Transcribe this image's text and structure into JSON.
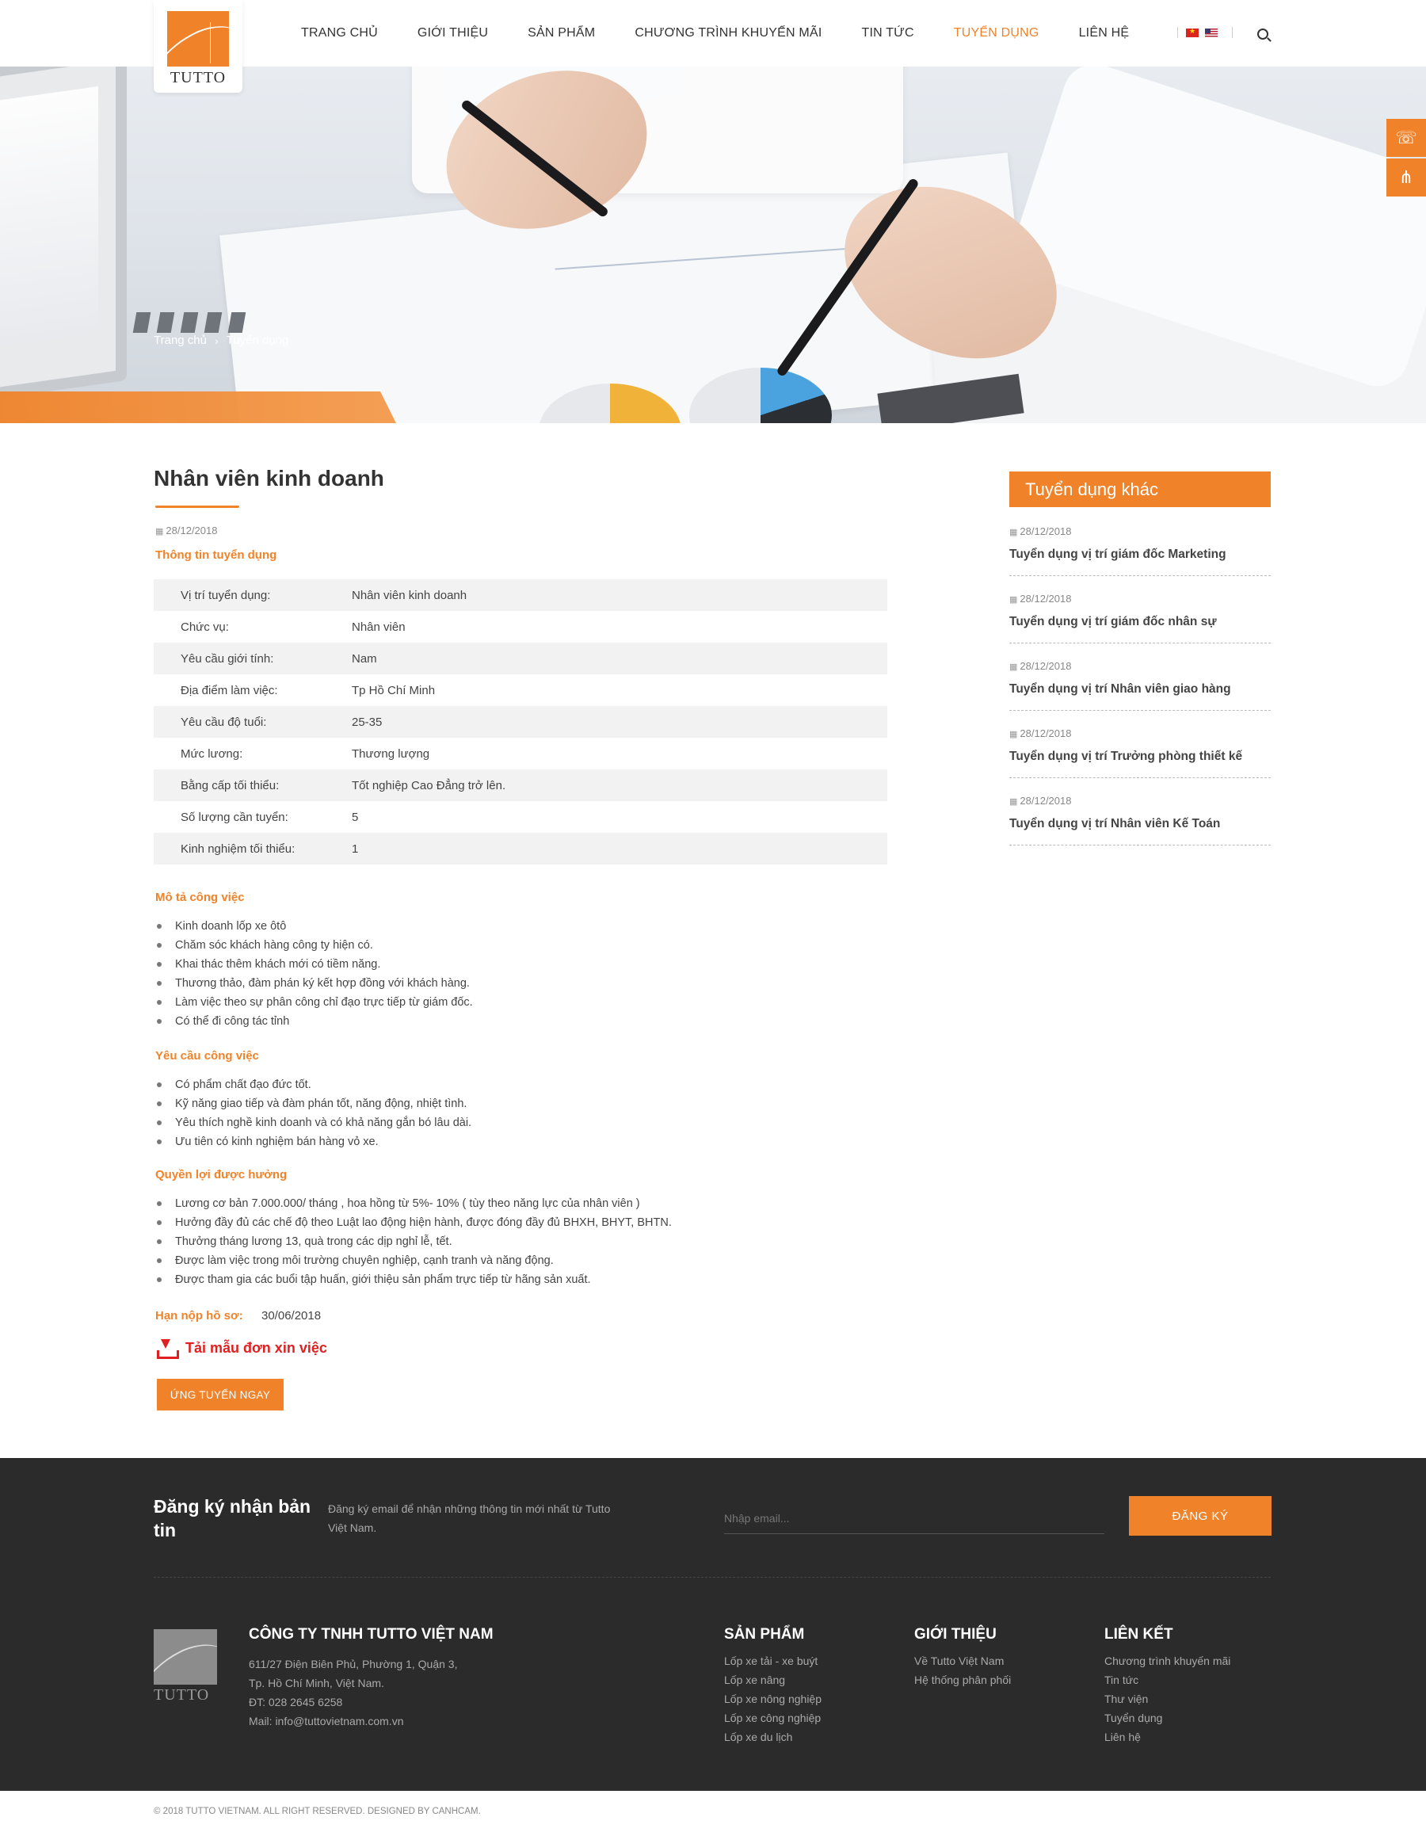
{
  "header": {
    "logo_text": "TUTTO",
    "nav": [
      "TRANG CHỦ",
      "GIỚI THIỆU",
      "SẢN PHẨM",
      "CHƯƠNG TRÌNH KHUYẾN MÃI",
      "TIN TỨC",
      "TUYỂN DỤNG",
      "LIÊN HỆ"
    ],
    "active_nav": "TUYỂN DỤNG",
    "languages": [
      "vi-flag-icon",
      "en-flag-icon"
    ]
  },
  "breadcrumb": [
    "Trang chủ",
    "Tuyển dụng"
  ],
  "side_widgets": [
    "phone-icon",
    "share-icon"
  ],
  "job": {
    "title": "Nhân viên kinh doanh",
    "date": "28/12/2018",
    "info_heading": "Thông tin tuyển dụng",
    "info": [
      {
        "label": "Vị trí tuyển dụng:",
        "value": "Nhân viên kinh doanh"
      },
      {
        "label": "Chức vụ:",
        "value": "Nhân viên"
      },
      {
        "label": "Yêu cầu giới tính:",
        "value": "Nam"
      },
      {
        "label": "Địa điểm làm việc:",
        "value": "Tp Hồ Chí Minh"
      },
      {
        "label": "Yêu cầu độ tuổi:",
        "value": "25-35"
      },
      {
        "label": "Mức lương:",
        "value": "Thương lượng"
      },
      {
        "label": "Bằng cấp tối thiểu:",
        "value": "Tốt nghiệp Cao Đẳng trở lên."
      },
      {
        "label": "Số lượng cần tuyển:",
        "value": "5"
      },
      {
        "label": "Kinh nghiệm tối thiểu:",
        "value": "1"
      }
    ],
    "description_heading": "Mô tả công việc",
    "description": [
      "Kinh doanh lốp xe ôtô",
      "Chăm sóc khách hàng công ty hiện có.",
      "Khai thác thêm khách mới có tiềm năng.",
      "Thương thảo, đàm phán ký kết hợp đồng với khách hàng.",
      "Làm việc theo sự phân công chỉ đạo trực tiếp từ giám đốc.",
      "Có thể đi công tác tỉnh"
    ],
    "requirements_heading": "Yêu cầu công việc",
    "requirements": [
      "Có phẩm chất đạo đức tốt.",
      "Kỹ năng giao tiếp và đàm phán tốt, năng động, nhiệt tình.",
      "Yêu thích nghề kinh doanh và có khả năng gắn bó lâu dài.",
      "Ưu tiên có kinh nghiệm bán hàng vỏ xe."
    ],
    "benefits_heading": "Quyền lợi được hưởng",
    "benefits": [
      " Lương cơ bản 7.000.000/ tháng , hoa hồng từ 5%- 10% ( tùy theo năng lực của nhân viên )",
      "Hưởng đầy đủ các chế độ theo Luật lao động hiện hành, được đóng đầy đủ BHXH, BHYT, BHTN.",
      "Thưởng tháng lương 13, quà trong các dịp nghỉ lễ, tết.",
      "Được làm việc trong môi trường chuyên nghiệp, cạnh tranh và năng động.",
      "Được tham gia các buổi tập huấn, giới thiệu sản phẩm trực tiếp từ hãng sản xuất."
    ],
    "deadline_label": "Hạn nộp hồ sơ:",
    "deadline_value": "30/06/2018",
    "download_label": "Tải mẫu đơn xin việc",
    "apply_label": "ỨNG TUYỂN NGAY"
  },
  "sidebar": {
    "heading": "Tuyển dụng khác",
    "items": [
      {
        "date": "28/12/2018",
        "title": "Tuyển dụng vị trí giám đốc Marketing"
      },
      {
        "date": "28/12/2018",
        "title": "Tuyển dụng vị trí giám đốc nhân sự"
      },
      {
        "date": "28/12/2018",
        "title": "Tuyển dụng vị trí Nhân viên giao hàng"
      },
      {
        "date": "28/12/2018",
        "title": "Tuyển dụng vị trí Trưởng phòng thiết kế"
      },
      {
        "date": "28/12/2018",
        "title": "Tuyển dụng vị trí Nhân viên Kế Toán"
      }
    ]
  },
  "newsletter": {
    "title": "Đăng ký nhận bản tin",
    "desc": "Đăng ký email để nhận những thông tin mới nhất từ Tutto Việt Nam.",
    "placeholder": "Nhập email...",
    "button": "ĐĂNG KÝ"
  },
  "footer": {
    "logo_text": "TUTTO",
    "company": "CÔNG TY TNHH TUTTO VIỆT NAM",
    "address1": "611/27 Điện Biên Phủ, Phường 1, Quận 3,",
    "address2": "Tp. Hồ Chí Minh, Việt Nam.",
    "phone": "ĐT: 028 2645 6258",
    "email": "Mail: info@tuttovietnam.com.vn",
    "columns": [
      {
        "title": "SẢN PHẨM",
        "links": [
          "Lốp xe tải - xe buýt",
          "Lốp xe nâng",
          "Lốp xe nông nghiệp",
          "Lốp xe công nghiệp",
          "Lốp xe du lịch"
        ]
      },
      {
        "title": "GIỚI THIỆU",
        "links": [
          "Về Tutto Việt Nam",
          "Hệ thống phân phối"
        ]
      },
      {
        "title": "LIÊN KẾT",
        "links": [
          "Chương trình khuyến  mãi",
          "Tin tức",
          "Thư viện",
          "Tuyển dụng",
          "Liên hệ"
        ]
      }
    ],
    "copyright": "© 2018 TUTTO VIETNAM. ALL RIGHT RESERVED. DESIGNED BY CANHCAM."
  },
  "colors": {
    "accent": "#f0832a",
    "footer_bg": "#2b2b2b",
    "download": "#e02020"
  }
}
